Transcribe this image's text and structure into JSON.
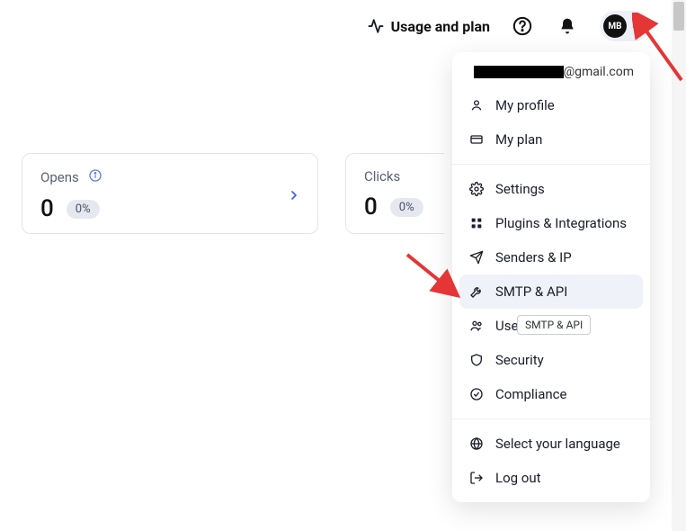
{
  "topbar": {
    "usage_plan": "Usage and plan",
    "avatar_initials": "MB"
  },
  "cards": {
    "opens": {
      "title": "Opens",
      "value": "0",
      "pct": "0%"
    },
    "clicks": {
      "title": "Clicks",
      "value": "0",
      "pct": "0%"
    }
  },
  "dropdown": {
    "email_suffix": "@gmail.com",
    "items": {
      "profile": "My profile",
      "plan": "My plan",
      "settings": "Settings",
      "plugins": "Plugins & Integrations",
      "senders": "Senders & IP",
      "smtp": "SMTP & API",
      "users": "Users",
      "security": "Security",
      "compliance": "Compliance",
      "language": "Select your language",
      "logout": "Log out"
    }
  },
  "tooltip": "SMTP & API"
}
